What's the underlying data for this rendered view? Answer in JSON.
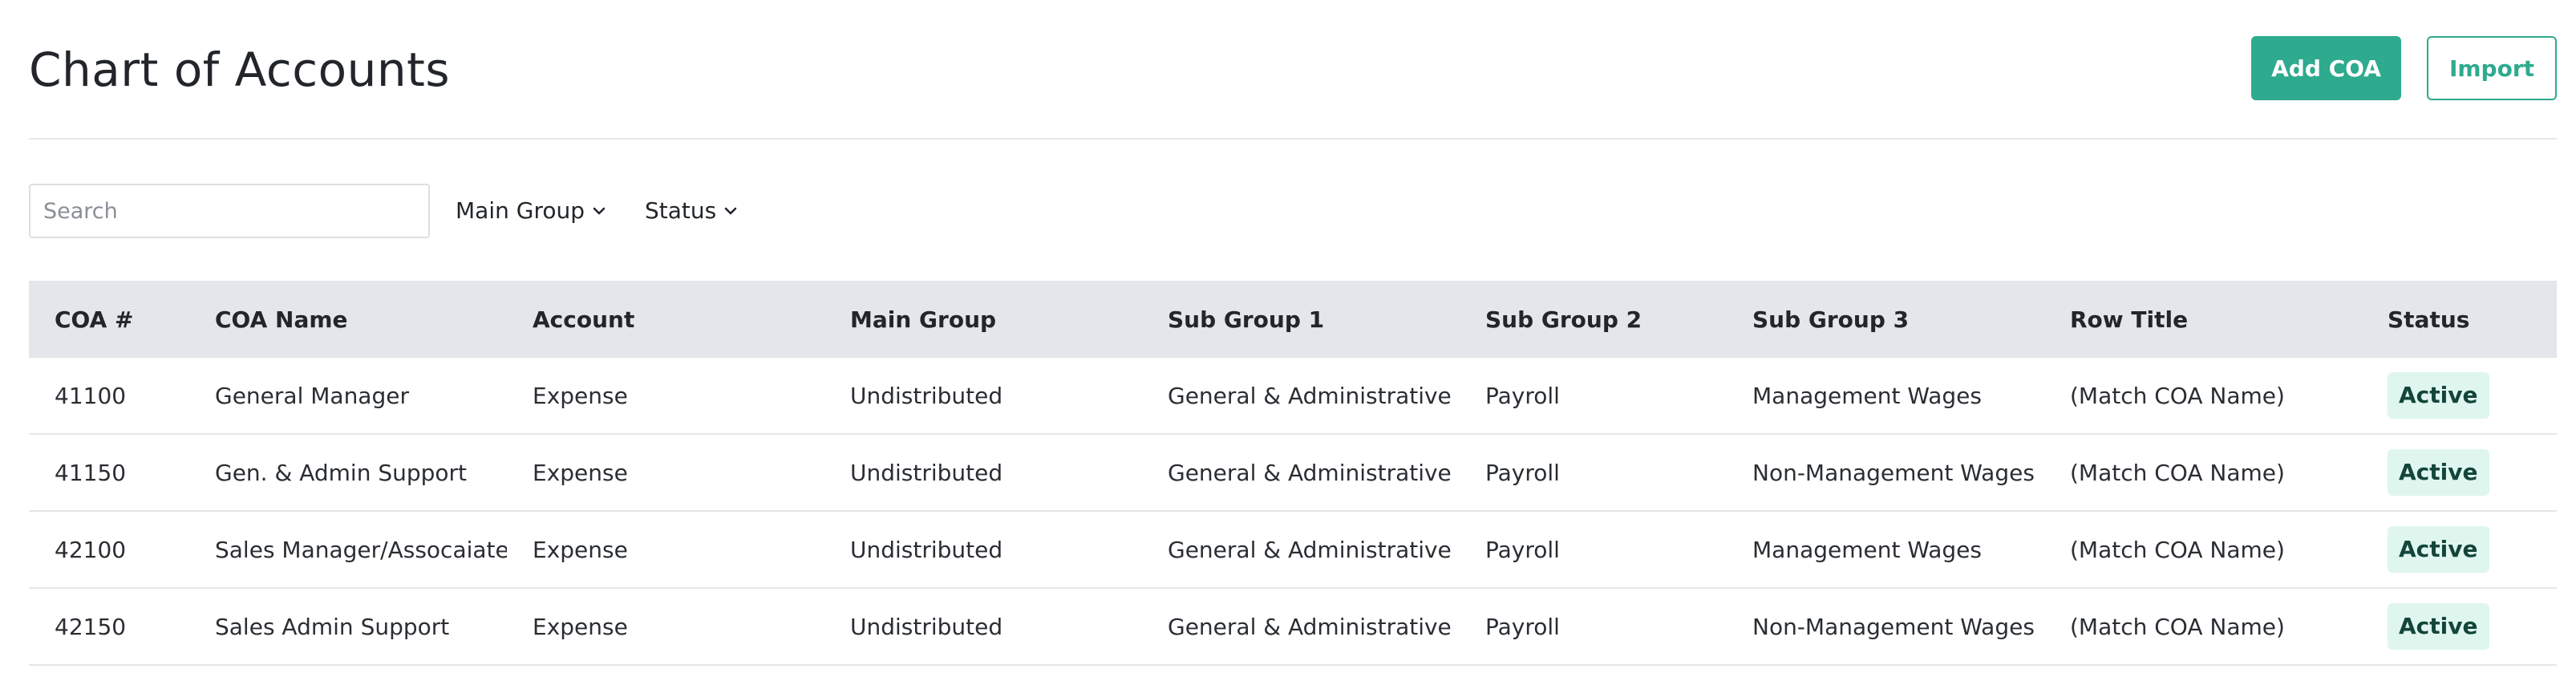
{
  "header": {
    "title": "Chart of Accounts",
    "add_button": "Add COA",
    "import_button": "Import"
  },
  "filters": {
    "search_placeholder": "Search",
    "search_value": "",
    "main_group_label": "Main Group",
    "status_label": "Status"
  },
  "table": {
    "columns": [
      "COA #",
      "COA Name",
      "Account",
      "Main Group",
      "Sub Group 1",
      "Sub Group 2",
      "Sub Group 3",
      "Row Title",
      "Status"
    ],
    "rows": [
      [
        "41100",
        "General Manager",
        "Expense",
        "Undistributed",
        "General & Administrative",
        "Payroll",
        "Management Wages",
        "(Match COA Name)",
        "Active"
      ],
      [
        "41150",
        "Gen. & Admin Support",
        "Expense",
        "Undistributed",
        "General & Administrative",
        "Payroll",
        "Non-Management Wages",
        "(Match COA Name)",
        "Active"
      ],
      [
        "42100",
        "Sales Manager/Assocaiate",
        "Expense",
        "Undistributed",
        "General & Administrative",
        "Payroll",
        "Management Wages",
        "(Match COA Name)",
        "Active"
      ],
      [
        "42150",
        "Sales Admin Support",
        "Expense",
        "Undistributed",
        "General & Administrative",
        "Payroll",
        "Non-Management Wages",
        "(Match COA Name)",
        "Active"
      ]
    ]
  },
  "colors": {
    "accent": "#2eaa8e",
    "header_row_bg": "#e3e6ea",
    "status_badge_bg": "#dff6ef"
  },
  "icons": {
    "dropdown": "chevron-down-icon"
  }
}
